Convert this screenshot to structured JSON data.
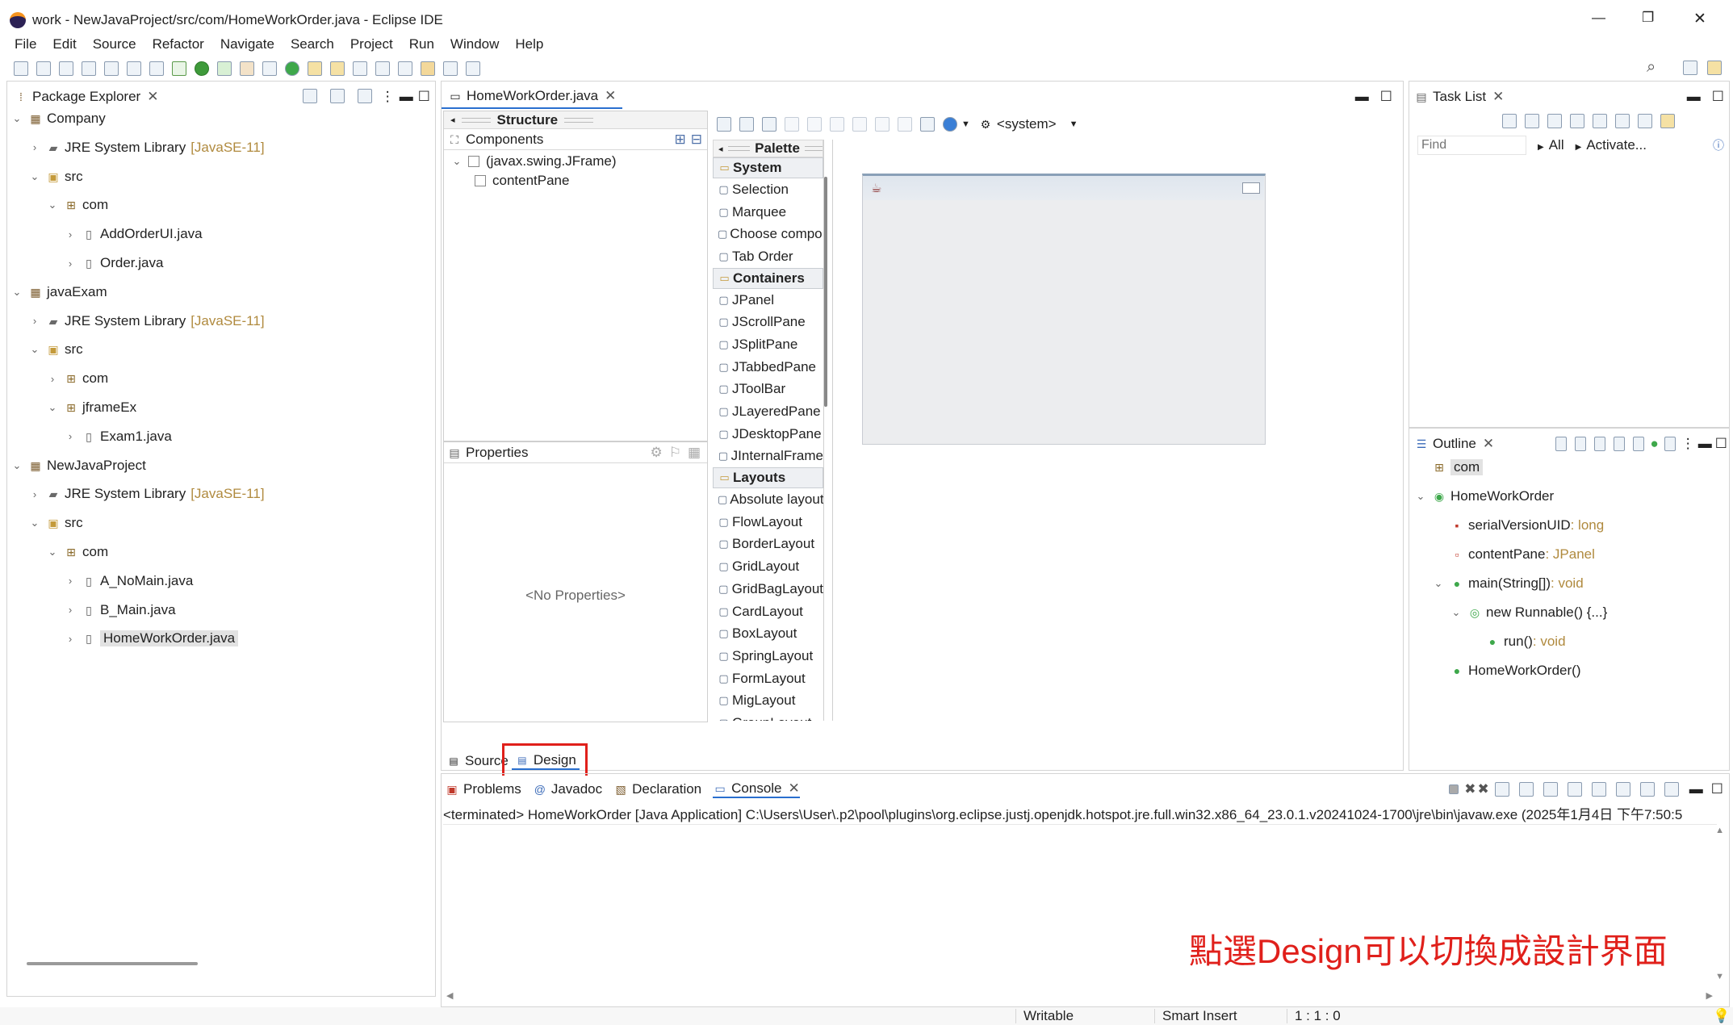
{
  "window": {
    "title": "work - NewJavaProject/src/com/HomeWorkOrder.java - Eclipse IDE",
    "controls": {
      "minimize": "—",
      "restore": "❐",
      "close": "✕"
    }
  },
  "menu": [
    "File",
    "Edit",
    "Source",
    "Refactor",
    "Navigate",
    "Search",
    "Project",
    "Run",
    "Window",
    "Help"
  ],
  "package_explorer": {
    "title": "Package Explorer",
    "tree": [
      {
        "label": "Company",
        "extra": "",
        "depth": 0,
        "chev": "v",
        "icon": "project-icon"
      },
      {
        "label": "JRE System Library",
        "extra": "[JavaSE-11]",
        "depth": 1,
        "chev": ">",
        "icon": "library-icon"
      },
      {
        "label": "src",
        "extra": "",
        "depth": 1,
        "chev": "v",
        "icon": "source-folder-icon"
      },
      {
        "label": "com",
        "extra": "",
        "depth": 2,
        "chev": "v",
        "icon": "package-icon"
      },
      {
        "label": "AddOrderUI.java",
        "extra": "",
        "depth": 3,
        "chev": ">",
        "icon": "java-file-icon"
      },
      {
        "label": "Order.java",
        "extra": "",
        "depth": 3,
        "chev": ">",
        "icon": "java-file-icon"
      },
      {
        "label": "javaExam",
        "extra": "",
        "depth": 0,
        "chev": "v",
        "icon": "project-icon"
      },
      {
        "label": "JRE System Library",
        "extra": "[JavaSE-11]",
        "depth": 1,
        "chev": ">",
        "icon": "library-icon"
      },
      {
        "label": "src",
        "extra": "",
        "depth": 1,
        "chev": "v",
        "icon": "source-folder-icon"
      },
      {
        "label": "com",
        "extra": "",
        "depth": 2,
        "chev": ">",
        "icon": "package-icon"
      },
      {
        "label": "jframeEx",
        "extra": "",
        "depth": 2,
        "chev": "v",
        "icon": "package-icon"
      },
      {
        "label": "Exam1.java",
        "extra": "",
        "depth": 3,
        "chev": ">",
        "icon": "java-file-icon"
      },
      {
        "label": "NewJavaProject",
        "extra": "",
        "depth": 0,
        "chev": "v",
        "icon": "project-icon"
      },
      {
        "label": "JRE System Library",
        "extra": "[JavaSE-11]",
        "depth": 1,
        "chev": ">",
        "icon": "library-icon"
      },
      {
        "label": "src",
        "extra": "",
        "depth": 1,
        "chev": "v",
        "icon": "source-folder-icon"
      },
      {
        "label": "com",
        "extra": "",
        "depth": 2,
        "chev": "v",
        "icon": "package-icon"
      },
      {
        "label": "A_NoMain.java",
        "extra": "",
        "depth": 3,
        "chev": ">",
        "icon": "java-file-icon"
      },
      {
        "label": "B_Main.java",
        "extra": "",
        "depth": 3,
        "chev": ">",
        "icon": "java-file-icon"
      },
      {
        "label": "HomeWorkOrder.java",
        "extra": "",
        "depth": 3,
        "chev": ">",
        "icon": "java-file-icon",
        "selected": true
      }
    ]
  },
  "editor": {
    "tab": "HomeWorkOrder.java",
    "structure_label": "Structure",
    "components_label": "Components",
    "components": [
      {
        "label": "(javax.swing.JFrame)",
        "depth": 0
      },
      {
        "label": "contentPane",
        "depth": 1
      }
    ],
    "properties_label": "Properties",
    "no_properties": "<No Properties>",
    "system_combo": "<system>",
    "palette_label": "Palette",
    "palette": [
      {
        "type": "cat",
        "label": "System"
      },
      {
        "type": "item",
        "label": "Selection",
        "icon": "cursor-icon"
      },
      {
        "type": "item",
        "label": "Marquee",
        "icon": "marquee-icon"
      },
      {
        "type": "item",
        "label": "Choose compo...",
        "icon": "choose-icon"
      },
      {
        "type": "item",
        "label": "Tab Order",
        "icon": "tab-order-icon"
      },
      {
        "type": "cat",
        "label": "Containers"
      },
      {
        "type": "item",
        "label": "JPanel",
        "icon": "jpanel-icon"
      },
      {
        "type": "item",
        "label": "JScrollPane",
        "icon": "jscrollpane-icon"
      },
      {
        "type": "item",
        "label": "JSplitPane",
        "icon": "jsplitpane-icon"
      },
      {
        "type": "item",
        "label": "JTabbedPane",
        "icon": "jtabbedpane-icon"
      },
      {
        "type": "item",
        "label": "JToolBar",
        "icon": "jtoolbar-icon"
      },
      {
        "type": "item",
        "label": "JLayeredPane",
        "icon": "jlayeredpane-icon"
      },
      {
        "type": "item",
        "label": "JDesktopPane",
        "icon": "jdesktoppane-icon"
      },
      {
        "type": "item",
        "label": "JInternalFrame",
        "icon": "jinternalframe-icon"
      },
      {
        "type": "cat",
        "label": "Layouts"
      },
      {
        "type": "item",
        "label": "Absolute layout",
        "icon": "absolute-layout-icon"
      },
      {
        "type": "item",
        "label": "FlowLayout",
        "icon": "flowlayout-icon"
      },
      {
        "type": "item",
        "label": "BorderLayout",
        "icon": "borderlayout-icon"
      },
      {
        "type": "item",
        "label": "GridLayout",
        "icon": "gridlayout-icon"
      },
      {
        "type": "item",
        "label": "GridBagLayout",
        "icon": "gridbaglayout-icon"
      },
      {
        "type": "item",
        "label": "CardLayout",
        "icon": "cardlayout-icon"
      },
      {
        "type": "item",
        "label": "BoxLayout",
        "icon": "boxlayout-icon"
      },
      {
        "type": "item",
        "label": "SpringLayout",
        "icon": "springlayout-icon"
      },
      {
        "type": "item",
        "label": "FormLayout",
        "icon": "formlayout-icon"
      },
      {
        "type": "item",
        "label": "MigLayout",
        "icon": "miglayout-icon"
      },
      {
        "type": "item",
        "label": "GroupLayout",
        "icon": "grouplayout-icon"
      }
    ],
    "bottom_tabs": {
      "source": "Source",
      "design": "Design"
    }
  },
  "task_list": {
    "title": "Task List",
    "find_placeholder": "Find",
    "all": "All",
    "activate": "Activate..."
  },
  "outline": {
    "title": "Outline",
    "items": [
      {
        "label": "com",
        "type": "",
        "depth": 0,
        "icon": "package-icon",
        "chev": ""
      },
      {
        "label": "HomeWorkOrder",
        "type": "",
        "depth": 0,
        "icon": "class-icon",
        "chev": "v"
      },
      {
        "label": "serialVersionUID",
        "type": " : long",
        "depth": 1,
        "icon": "field-icon",
        "chev": ""
      },
      {
        "label": "contentPane",
        "type": " : JPanel",
        "depth": 1,
        "icon": "private-field-icon",
        "chev": ""
      },
      {
        "label": "main(String[])",
        "type": " : void",
        "depth": 1,
        "icon": "method-icon",
        "chev": "v"
      },
      {
        "label": "new Runnable() {...}",
        "type": "",
        "depth": 2,
        "icon": "anonymous-class-icon",
        "chev": "v"
      },
      {
        "label": "run()",
        "type": " : void",
        "depth": 3,
        "icon": "method-icon",
        "chev": ""
      },
      {
        "label": "HomeWorkOrder()",
        "type": "",
        "depth": 1,
        "icon": "constructor-icon",
        "chev": ""
      }
    ]
  },
  "console": {
    "tabs": [
      "Problems",
      "Javadoc",
      "Declaration",
      "Console"
    ],
    "active_tab": "Console",
    "status_line": "<terminated> HomeWorkOrder [Java Application] C:\\Users\\User\\.p2\\pool\\plugins\\org.eclipse.justj.openjdk.hotspot.jre.full.win32.x86_64_23.0.1.v20241024-1700\\jre\\bin\\javaw.exe  (2025年1月4日 下午7:50:5"
  },
  "annotation": {
    "text": "點選Design可以切換成設計界面",
    "color": "#e0201b"
  },
  "status_bar": {
    "writable": "Writable",
    "insert_mode": "Smart Insert",
    "position": "1 : 1 : 0"
  },
  "colors": {
    "highlight_box": "#e0201b",
    "selection_bg": "#e2e2e2",
    "type_label": "#b08a3e"
  }
}
